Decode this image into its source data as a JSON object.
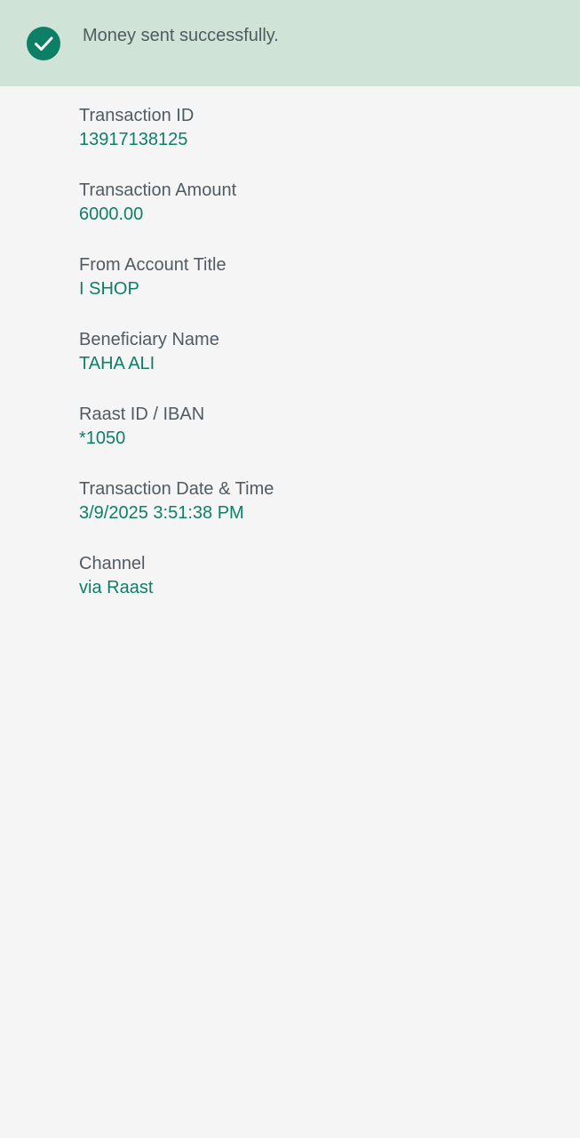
{
  "banner": {
    "icon": "check-circle-icon",
    "message": "Money sent successfully."
  },
  "colors": {
    "banner_background": "#cfe3d6",
    "accent_green": "#0e7f67",
    "label_gray": "#505b62",
    "page_background": "#f5f5f6"
  },
  "details": [
    {
      "label": "Transaction ID",
      "value": "13917138125"
    },
    {
      "label": "Transaction Amount",
      "value": "6000.00"
    },
    {
      "label": "From Account Title",
      "value": "I SHOP"
    },
    {
      "label": "Beneficiary Name",
      "value": "TAHA ALI"
    },
    {
      "label": "Raast ID / IBAN",
      "value": "*1050"
    },
    {
      "label": "Transaction Date & Time",
      "value": "3/9/2025 3:51:38 PM"
    },
    {
      "label": "Channel",
      "value": "via Raast"
    }
  ]
}
